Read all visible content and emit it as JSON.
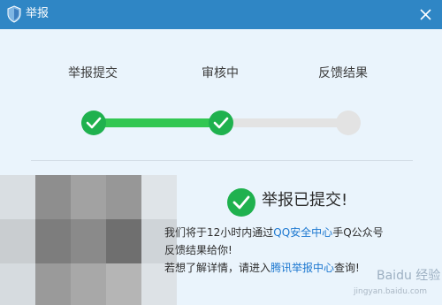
{
  "window": {
    "title": "举报",
    "close_icon": "close-icon"
  },
  "steps": [
    {
      "label": "举报提交",
      "status": "done"
    },
    {
      "label": "审核中",
      "status": "done"
    },
    {
      "label": "反馈结果",
      "status": "pending"
    }
  ],
  "progress": {
    "completed_steps": 2,
    "total_steps": 3
  },
  "result": {
    "title": "举报已提交!",
    "line1_prefix": "我们将于12小时内通过",
    "line1_link": "QQ安全中心",
    "line1_suffix": "手Q公众号",
    "line2": "反馈结果给你!",
    "line3_prefix": "若想了解详情，请进入",
    "line3_link": "腾讯举报中心",
    "line3_suffix": "查询!"
  },
  "watermark": {
    "main": "Baidu 经验",
    "sub": "jingyan.baidu.com"
  },
  "colors": {
    "titlebar": "#2f86c5",
    "background": "#eaf4fc",
    "success": "#1fb14e",
    "progress": "#33c752",
    "pending": "#e3e3e3",
    "link": "#1d78d0"
  }
}
